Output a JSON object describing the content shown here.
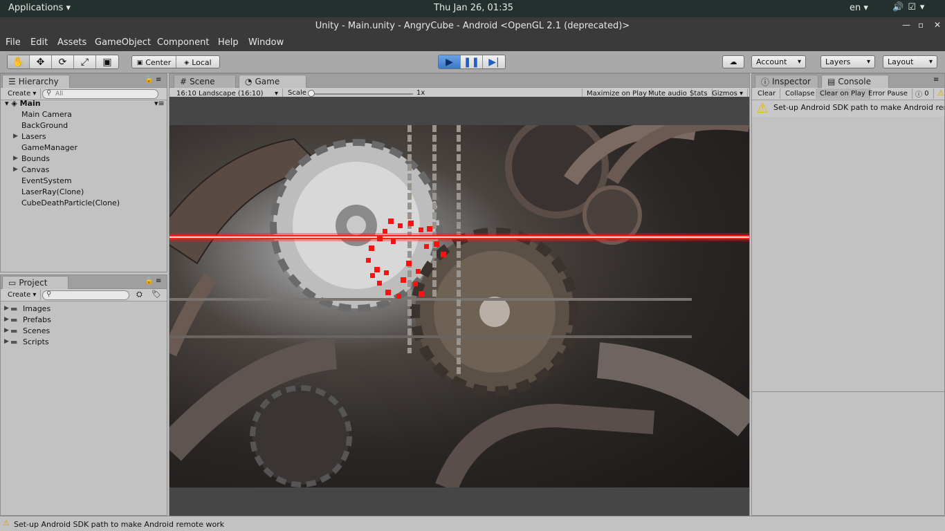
{
  "system": {
    "applications_label": "Applications",
    "clock": "Thu Jan 26, 01:35",
    "language": "en"
  },
  "window": {
    "title": "Unity - Main.unity - AngryCube - Android <OpenGL 2.1 (deprecated)>"
  },
  "menu": {
    "items": [
      "File",
      "Edit",
      "Assets",
      "GameObject",
      "Component",
      "Help",
      "Window"
    ]
  },
  "toolbar": {
    "center_label": "Center",
    "local_label": "Local",
    "account_label": "Account",
    "layers_label": "Layers",
    "layout_label": "Layout"
  },
  "hierarchy": {
    "tab_label": "Hierarchy",
    "create_label": "Create",
    "search_placeholder": "All",
    "scene_name": "Main",
    "items": [
      {
        "label": "Main Camera",
        "expandable": false
      },
      {
        "label": "BackGround",
        "expandable": false
      },
      {
        "label": "Lasers",
        "expandable": true
      },
      {
        "label": "GameManager",
        "expandable": false
      },
      {
        "label": "Bounds",
        "expandable": true
      },
      {
        "label": "Canvas",
        "expandable": true
      },
      {
        "label": "EventSystem",
        "expandable": false
      },
      {
        "label": "LaserRay(Clone)",
        "expandable": false
      },
      {
        "label": "CubeDeathParticle(Clone)",
        "expandable": false
      }
    ]
  },
  "project": {
    "tab_label": "Project",
    "create_label": "Create",
    "folders": [
      "Images",
      "Prefabs",
      "Scenes",
      "Scripts"
    ]
  },
  "center": {
    "scene_tab": "Scene",
    "game_tab": "Game",
    "aspect_label": "16:10 Landscape (16:10)",
    "scale_label": "Scale",
    "scale_value": "1x",
    "maximize_label": "Maximize on Play",
    "mute_label": "Mute audio",
    "stats_label": "Stats",
    "gizmos_label": "Gizmos"
  },
  "right": {
    "inspector_tab": "Inspector",
    "console_tab": "Console",
    "clear_label": "Clear",
    "collapse_label": "Collapse",
    "clear_on_play_label": "Clear on Play",
    "error_pause_label": "Error Pause",
    "count_label": "0",
    "console_message": "Set-up Android SDK path to make Android remote work"
  },
  "status": {
    "message": "Set-up Android SDK path to make Android remote work"
  },
  "colors": {
    "laser": "#ff1010",
    "play_active": "#3c78c8",
    "warning": "#f0c020"
  }
}
